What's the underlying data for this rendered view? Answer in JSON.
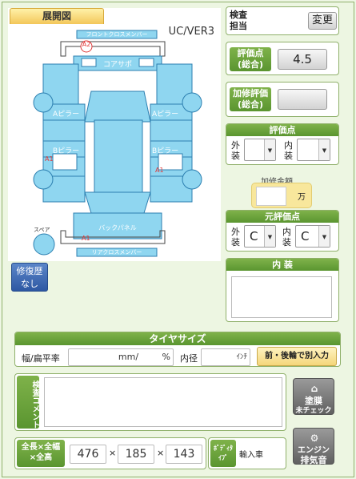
{
  "diagram": {
    "tab_label": "展開図",
    "model": "UC/VER3",
    "parts": {
      "front_cross_member": "フロントクロスメンバー",
      "core_support": "コアサポ",
      "a_pillar_left": "Aピラー",
      "a_pillar_right": "Aピラー",
      "b_pillar_left": "Bピラー",
      "b_pillar_right": "Bピラー",
      "back_panel": "バックパネル",
      "rear_cross_member": "リアクロスメンバー",
      "spare": "スペア"
    },
    "marks": {
      "a2_front": "A2",
      "a1_left": "A1",
      "a1_right": "A1",
      "a1_rear": "A1"
    }
  },
  "repair_history": {
    "label_line1": "修復歴",
    "label_line2": "なし"
  },
  "inspector": {
    "label_line1": "検査",
    "label_line2": "担当",
    "change_button": "変更"
  },
  "overall_score": {
    "label_line1": "評価点",
    "label_line2": "(総合)",
    "value": "4.5"
  },
  "additional_score": {
    "label_line1": "加修評価",
    "label_line2": "(総合)",
    "value": ""
  },
  "score_section": {
    "title": "評価点",
    "exterior_label_1": "外",
    "exterior_label_2": "装",
    "exterior_value": "",
    "interior_label_1": "内",
    "interior_label_2": "装",
    "interior_value": ""
  },
  "repair_amount": {
    "title": "加修金額",
    "unit": "万",
    "value": ""
  },
  "original_score": {
    "title": "元評価点",
    "exterior_label_1": "外",
    "exterior_label_2": "装",
    "exterior_value": "C",
    "interior_label_1": "内",
    "interior_label_2": "装",
    "interior_value": "C"
  },
  "interior": {
    "title": "内 装",
    "value": ""
  },
  "tire": {
    "title": "タイヤサイズ",
    "width_label": "幅/扁平率",
    "mm_unit": "mm/",
    "pct_unit": "%",
    "diameter_label": "内径",
    "inch_unit": "ｲﾝﾁ",
    "split_button": "前・後輪で別入力"
  },
  "comment": {
    "label": "検査コメント",
    "value": ""
  },
  "paint_button": {
    "line1": "塗膜",
    "line2": "未チェック"
  },
  "engine_button": {
    "line1": "エンジン",
    "line2": "排気音"
  },
  "dimensions": {
    "label_line1": "全長×全幅",
    "label_line2": "×全高",
    "length": "476",
    "width": "185",
    "height": "143",
    "sep": "×"
  },
  "body_type": {
    "label_line1": "ﾎﾞﾃﾞｨﾀ",
    "label_line2": "ｲﾌﾟ",
    "value": "輸入車"
  },
  "colors": {
    "panel_fill": "#8fd6f0",
    "panel_stroke": "#2c7fb0",
    "accent_green": "#6aa23c",
    "mark_red": "#e03a3a"
  }
}
